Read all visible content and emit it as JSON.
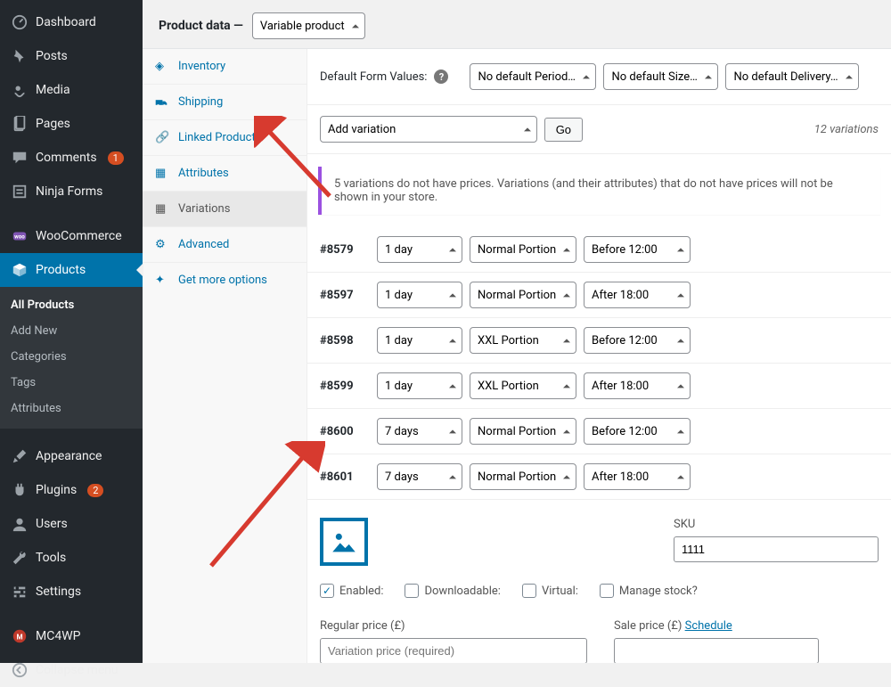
{
  "sidebar": {
    "items": [
      {
        "icon": "dashboard",
        "label": "Dashboard"
      },
      {
        "icon": "pin",
        "label": "Posts"
      },
      {
        "icon": "media",
        "label": "Media"
      },
      {
        "icon": "page",
        "label": "Pages"
      },
      {
        "icon": "comment",
        "label": "Comments",
        "badge": "1"
      },
      {
        "icon": "form",
        "label": "Ninja Forms"
      },
      {
        "icon": "woo",
        "label": "WooCommerce"
      },
      {
        "icon": "product",
        "label": "Products",
        "active": true
      },
      {
        "icon": "appearance",
        "label": "Appearance"
      },
      {
        "icon": "plugin",
        "label": "Plugins",
        "badge": "2"
      },
      {
        "icon": "user",
        "label": "Users"
      },
      {
        "icon": "tool",
        "label": "Tools"
      },
      {
        "icon": "settings",
        "label": "Settings"
      },
      {
        "icon": "mc",
        "label": "MC4WP"
      },
      {
        "icon": "collapse",
        "label": "Collapse menu"
      }
    ],
    "submenu": [
      {
        "label": "All Products",
        "selected": true
      },
      {
        "label": "Add New"
      },
      {
        "label": "Categories"
      },
      {
        "label": "Tags"
      },
      {
        "label": "Attributes"
      }
    ]
  },
  "product_data": {
    "heading": "Product data —",
    "type_value": "Variable product",
    "tabs": [
      {
        "icon": "inventory",
        "label": "Inventory"
      },
      {
        "icon": "shipping",
        "label": "Shipping"
      },
      {
        "icon": "link",
        "label": "Linked Products"
      },
      {
        "icon": "attributes",
        "label": "Attributes"
      },
      {
        "icon": "variations",
        "label": "Variations",
        "active": true
      },
      {
        "icon": "advanced",
        "label": "Advanced"
      },
      {
        "icon": "more",
        "label": "Get more options"
      }
    ]
  },
  "defaults": {
    "label": "Default Form Values:",
    "selects": [
      "No default Period…",
      "No default Size…",
      "No default Delivery…"
    ]
  },
  "addvar": {
    "select": "Add variation",
    "go": "Go",
    "count": "12 variations"
  },
  "notice": "5 variations do not have prices. Variations (and their attributes) that do not have prices will not be shown in your store.",
  "variations": [
    {
      "id": "#8579",
      "period": "1 day",
      "size": "Normal Portion",
      "delivery": "Before 12:00"
    },
    {
      "id": "#8597",
      "period": "1 day",
      "size": "Normal Portion",
      "delivery": "After 18:00"
    },
    {
      "id": "#8598",
      "period": "1 day",
      "size": "XXL Portion",
      "delivery": "Before 12:00"
    },
    {
      "id": "#8599",
      "period": "1 day",
      "size": "XXL Portion",
      "delivery": "After 18:00"
    },
    {
      "id": "#8600",
      "period": "7 days",
      "size": "Normal Portion",
      "delivery": "Before 12:00"
    },
    {
      "id": "#8601",
      "period": "7 days",
      "size": "Normal Portion",
      "delivery": "After 18:00"
    }
  ],
  "detail": {
    "sku_label": "SKU",
    "sku_value": "1111",
    "checks": {
      "enabled": {
        "label": "Enabled:",
        "checked": true
      },
      "downloadable": {
        "label": "Downloadable:",
        "checked": false
      },
      "virtual": {
        "label": "Virtual:",
        "checked": false
      },
      "manage": {
        "label": "Manage stock?",
        "checked": false
      }
    },
    "regular_label": "Regular price (£)",
    "regular_placeholder": "Variation price (required)",
    "sale_label": "Sale price (£) ",
    "schedule": "Schedule"
  }
}
